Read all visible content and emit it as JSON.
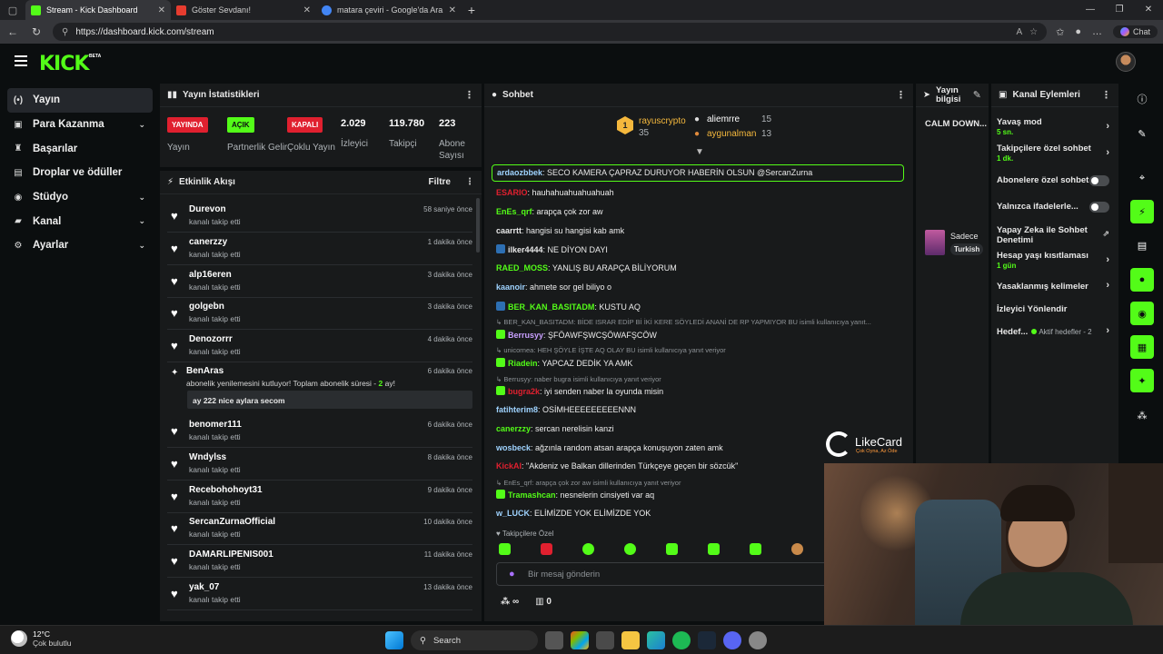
{
  "browser": {
    "tabs": [
      {
        "title": "Stream - Kick Dashboard",
        "fav_color": "#53fc18",
        "active": true
      },
      {
        "title": "Göster Sevdanı!",
        "fav_color": "#e63c2f",
        "active": false
      },
      {
        "title": "matara çeviri - Google'da Ara",
        "fav_color": "#4285f4",
        "active": false
      }
    ],
    "url": "https://dashboard.kick.com/stream",
    "chat_button": "Chat"
  },
  "kick": {
    "logo": "KICK",
    "beta": "BETA"
  },
  "nav": [
    {
      "label": "Yayın",
      "icon": "(•)",
      "chevron": false,
      "active": true
    },
    {
      "label": "Para Kazanma",
      "icon": "▣",
      "chevron": true,
      "active": false
    },
    {
      "label": "Başarılar",
      "icon": "♜",
      "chevron": false,
      "active": false
    },
    {
      "label": "Droplar ve ödüller",
      "icon": "▤",
      "chevron": false,
      "active": false
    },
    {
      "label": "Stüdyo",
      "icon": "◉",
      "chevron": true,
      "active": false
    },
    {
      "label": "Kanal",
      "icon": "▰",
      "chevron": true,
      "active": false
    },
    {
      "label": "Ayarlar",
      "icon": "⚙",
      "chevron": true,
      "active": false
    }
  ],
  "stats": {
    "title": "Yayın İstatistikleri",
    "items": [
      {
        "badge": "YAYINDA",
        "badge_bg": "#e0202f",
        "badge_fg": "#ffffff",
        "label": "Yayın"
      },
      {
        "badge": "AÇIK",
        "badge_bg": "#53fc18",
        "badge_fg": "#0b0e0f",
        "label": "Partnerlik Gelir"
      },
      {
        "badge": "KAPALI",
        "badge_bg": "#e0202f",
        "badge_fg": "#ffffff",
        "label": "Çoklu Yayın"
      }
    ],
    "numbers": [
      {
        "value": "2.029",
        "label": "İzleyici"
      },
      {
        "value": "119.780",
        "label": "Takipçi"
      },
      {
        "value": "223",
        "label": "Abone Sayısı"
      }
    ]
  },
  "feed": {
    "title": "Etkinlik Akışı",
    "filter": "Filtre",
    "items": [
      {
        "name": "Durevon",
        "sub": "kanalı takip etti",
        "time": "58 saniye önce"
      },
      {
        "name": "canerzzy",
        "sub": "kanalı takip etti",
        "time": "1 dakika önce"
      },
      {
        "name": "alp16eren",
        "sub": "kanalı takip etti",
        "time": "3 dakika önce"
      },
      {
        "name": "golgebn",
        "sub": "kanalı takip etti",
        "time": "3 dakika önce"
      },
      {
        "name": "Denozorrr",
        "sub": "kanalı takip etti",
        "time": "4 dakika önce"
      }
    ],
    "sub_event": {
      "name": "BenAras",
      "text": "abonelik yenilemesini kutluyor! Toplam abonelik süresi - ",
      "months": "2",
      "suffix": " ay!",
      "time": "6 dakika önce",
      "note": "ay 222 nice aylara secom"
    },
    "items2": [
      {
        "name": "benomer111",
        "sub": "kanalı takip etti",
        "time": "6 dakika önce"
      },
      {
        "name": "Wndylss",
        "sub": "kanalı takip etti",
        "time": "8 dakika önce"
      },
      {
        "name": "Recebohohoyt31",
        "sub": "kanalı takip etti",
        "time": "9 dakika önce"
      },
      {
        "name": "SercanZurnaOfficial",
        "sub": "kanalı takip etti",
        "time": "10 dakika önce"
      },
      {
        "name": "DAMARLIPENIS001",
        "sub": "kanalı takip etti",
        "time": "11 dakika önce"
      },
      {
        "name": "yak_07",
        "sub": "kanalı takip etti",
        "time": "13 dakika önce"
      }
    ]
  },
  "chat": {
    "title": "Sohbet",
    "leaders": [
      {
        "name": "rayuscrypto",
        "count": "35"
      },
      {
        "name": "aliemrre",
        "count": "15"
      },
      {
        "name": "aygunalman",
        "count": "13"
      }
    ],
    "leader_rank": "1",
    "highlight": {
      "user": "ardaozbbek",
      "text": ": SECO KAMERA ÇAPRAZ DURUYOR HABERİN OLSUN @SercanZurna"
    },
    "messages": [
      {
        "user": "ESARIO",
        "color": "#e0202f",
        "text": ": hauhahuahuahuahuah"
      },
      {
        "user": "EnEs_qrf",
        "color": "#53fc18",
        "text": ": arapça çok zor aw"
      },
      {
        "user": "caarrtt",
        "color": "#e8e8e8",
        "text": ": hangisi su hangisi kab amk"
      },
      {
        "user": "ilker4444",
        "color": "#e8e8e8",
        "text": ": NE DİYON DAYI"
      },
      {
        "user": "RAED_MOSS",
        "color": "#53fc18",
        "text": ": YANLIŞ BU ARAPÇA BİLİYORUM"
      },
      {
        "user": "kaanoir",
        "color": "#9fd3ff",
        "text": ": ahmete sor gel biliyo o"
      },
      {
        "user": "BER_KAN_BASITADM",
        "color": "#53fc18",
        "text": ": KUSTU AQ"
      },
      {
        "user": "Berrusyy",
        "color": "#c9a0ff",
        "text": ": ŞFÖAWFŞWCŞÖWAFŞCÖW"
      },
      {
        "user": "Riadein",
        "color": "#53fc18",
        "text": ": YAPCAZ DEDİK YA AMK"
      },
      {
        "user": "bugra2k",
        "color": "#e0202f",
        "text": ": iyi senden naber la oyunda misin"
      },
      {
        "user": "fatihterim8",
        "color": "#9fd3ff",
        "text": ": OSİMHEEEEEEEEENNN"
      },
      {
        "user": "canerzzy",
        "color": "#53fc18",
        "text": ": sercan nerelisin kanzi"
      },
      {
        "user": "wosbeck",
        "color": "#9fd3ff",
        "text": ": ağzınla random atsan arapça konuşuyon zaten amk"
      },
      {
        "user": "KickAI",
        "color": "#e0202f",
        "text": ": \"Akdeniz ve Balkan dillerinden Türkçeye geçen bir sözcük\""
      },
      {
        "user": "Tramashcan",
        "color": "#53fc18",
        "text": ": nesnelerin cinsiyeti var aq"
      },
      {
        "user": "w_LUCK",
        "color": "#9fd3ff",
        "text": ": ELİMİZDE YOK ELİMİZDE YOK"
      }
    ],
    "replies": [
      "BER_KAN_BASITADM: BİDE ISRAR EDİP Bİ İKİ KERE SÖYLEDİ ANANİ DE RP YAPMIYOR BU isimli kullanıcıya yanıt...",
      "unicornea: HEH ŞÖYLE İŞTE AQ OLAY BU isimli kullanıcıya yanıt veriyor",
      "Berrusyy: naber bugra isimli kullanıcıya yanıt veriyor",
      "EnEs_qrf: arapça çok zor aw isimli kullanıcıya yanıt veriyor"
    ],
    "followers_only": "Takipçilere Özel",
    "input_placeholder": "Bir mesaj gönderin",
    "bottom_count": "0"
  },
  "likecard": {
    "title": "LikeCard",
    "sub": "Çok Oyna, Az Öde"
  },
  "stream_info": {
    "title": "Yayın bilgisi",
    "stream_title": "CALM DOWN...",
    "category": "Sadece",
    "tag": "Turkish"
  },
  "actions": {
    "title": "Kanal Eylemleri",
    "slow": {
      "label": "Yavaş mod",
      "value": "5 sn."
    },
    "followers": {
      "label": "Takipçilere özel sohbet",
      "value": "1 dk."
    },
    "subs": "Abonelere özel sohbet",
    "emotes": "Yalnızca ifadelerle...",
    "ai": "Yapay Zeka ile Sohbet Denetimi",
    "age": {
      "label": "Hesap yaşı kısıtlaması",
      "value": "1 gün"
    },
    "banned": "Yasaklanmış kelimeler",
    "redirect": "İzleyici Yönlendir",
    "goals": {
      "label": "Hedef...",
      "status": "Aktif hedefler - 2"
    }
  },
  "taskbar": {
    "temp": "12°C",
    "weather": "Çok bulutlu",
    "search": "Search"
  }
}
